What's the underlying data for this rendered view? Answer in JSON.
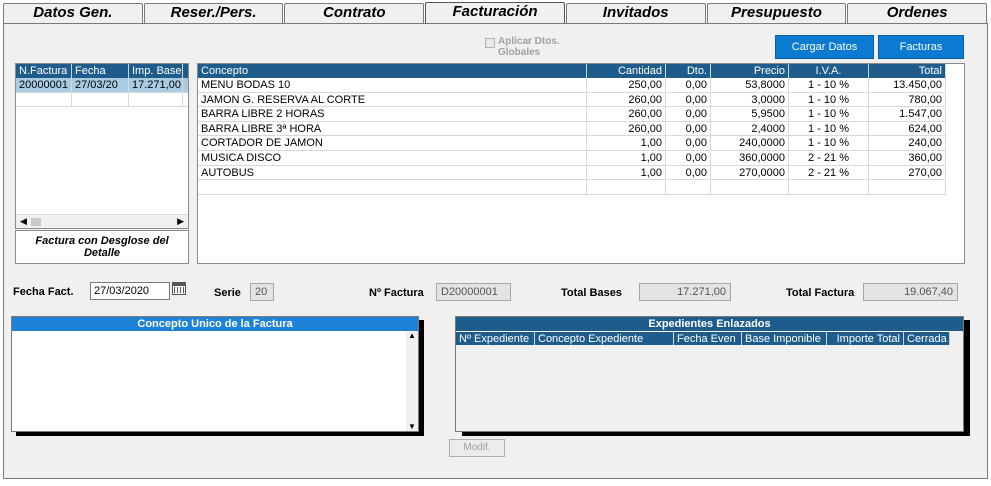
{
  "tabs": [
    "Datos Gen.",
    "Reser./Pers.",
    "Contrato",
    "Facturación",
    "Invitados",
    "Presupuesto",
    "Ordenes"
  ],
  "aplicar_dtos": "Aplicar Dtos. Globales",
  "buttons": {
    "cargar_datos": "Cargar Datos",
    "facturas": "Facturas",
    "modif": "Modif."
  },
  "invoice_list": {
    "columns": [
      "N.Factura",
      "Fecha",
      "Imp. Base"
    ],
    "rows": [
      [
        "20000001",
        "27/03/20",
        "17.271,00"
      ]
    ]
  },
  "desglose_label": "Factura con Desglose del Detalle",
  "concept_grid": {
    "columns": [
      "Concepto",
      "Cantidad",
      "Dto.",
      "Precio",
      "I.V.A.",
      "Total"
    ],
    "rows": [
      [
        "MENU BODAS 10",
        "250,00",
        "0,00",
        "53,8000",
        "1 - 10 %",
        "13.450,00"
      ],
      [
        "JAMON G. RESERVA AL CORTE",
        "260,00",
        "0,00",
        "3,0000",
        "1 - 10 %",
        "780,00"
      ],
      [
        "BARRA LIBRE 2 HORAS",
        "260,00",
        "0,00",
        "5,9500",
        "1 - 10 %",
        "1.547,00"
      ],
      [
        "BARRA LIBRE 3ª HORA",
        "260,00",
        "0,00",
        "2,4000",
        "1 - 10 %",
        "624,00"
      ],
      [
        "CORTADOR DE JAMON",
        "1,00",
        "0,00",
        "240,0000",
        "1 - 10 %",
        "240,00"
      ],
      [
        "MUSICA DISCO",
        "1,00",
        "0,00",
        "360,0000",
        "2 - 21 %",
        "360,00"
      ],
      [
        "AUTOBUS",
        "1,00",
        "0,00",
        "270,0000",
        "2 - 21 %",
        "270,00"
      ]
    ]
  },
  "fields": {
    "fecha_fact_label": "Fecha Fact.",
    "fecha_fact_value": "27/03/2020",
    "serie_label": "Serie",
    "serie_value": "20",
    "nfactura_label": "Nº Factura",
    "nfactura_value": "D20000001",
    "total_bases_label": "Total Bases",
    "total_bases_value": "17.271,00",
    "total_factura_label": "Total Factura",
    "total_factura_value": "19.067,40"
  },
  "concepto_unico_title": "Concepto Unico de la Factura",
  "expedientes": {
    "title": "Expedientes Enlazados",
    "columns": [
      "Nº Expediente",
      "Concepto Expediente",
      "Fecha Even",
      "Base Imponible",
      "Importe Total",
      "Cerrada"
    ]
  }
}
